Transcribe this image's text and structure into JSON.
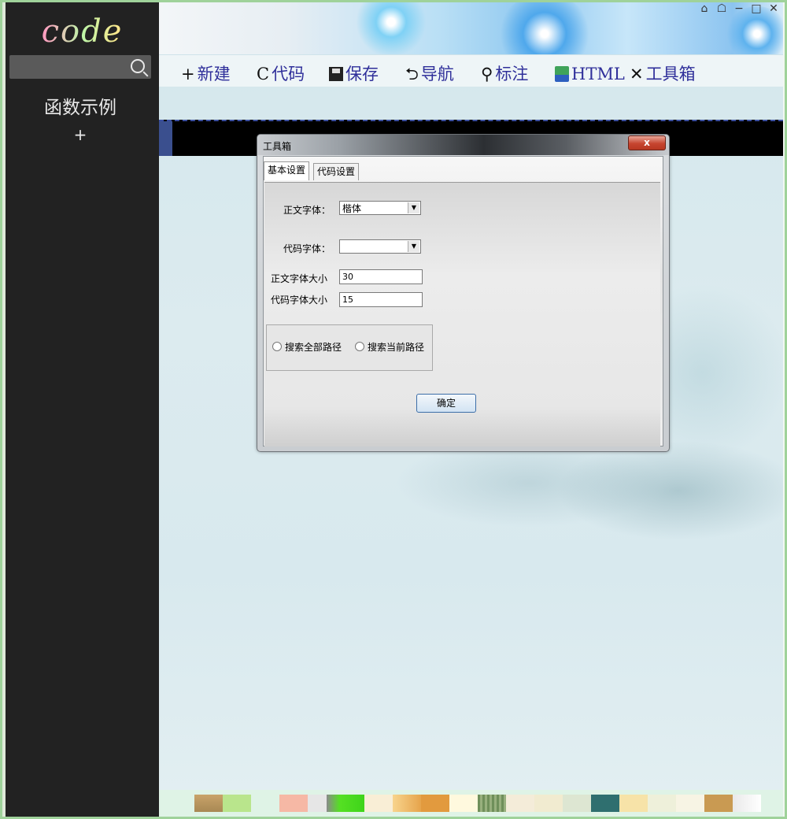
{
  "sidebar": {
    "logo": "code",
    "search_placeholder": "",
    "section_title": "函数示例",
    "add_label": "+"
  },
  "window_controls": {
    "home": "⌂",
    "skin": "☖",
    "minimize": "−",
    "maximize": "□",
    "close": "✕"
  },
  "toolbar": {
    "new": {
      "icon": "+",
      "label": "新建"
    },
    "code": {
      "icon": "C",
      "label": "代码"
    },
    "save": {
      "label": "保存"
    },
    "nav": {
      "icon": "⮌",
      "label": "导航"
    },
    "mark": {
      "icon": "⚲",
      "label": "标注"
    },
    "html": {
      "label": "HTML"
    },
    "tools": {
      "icon": "✕",
      "label": "工具箱"
    }
  },
  "dialog": {
    "title": "工具箱",
    "close_label": "x",
    "tabs": [
      "基本设置",
      "代码设置"
    ],
    "body_font_label": "正文字体：",
    "body_font_value": "楷体",
    "code_font_label": "代码字体：",
    "code_font_value": "",
    "body_size_label": "正文字体大小",
    "body_size_value": "30",
    "code_size_label": "代码字体大小",
    "code_size_value": "15",
    "search_all_label": "搜索全部路径",
    "search_current_label": "搜索当前路径",
    "ok_label": "确定"
  },
  "colors": {
    "sidebar_bg": "#222222",
    "toolbar_text": "#2f2f9a",
    "dialog_close": "#c6452f"
  }
}
